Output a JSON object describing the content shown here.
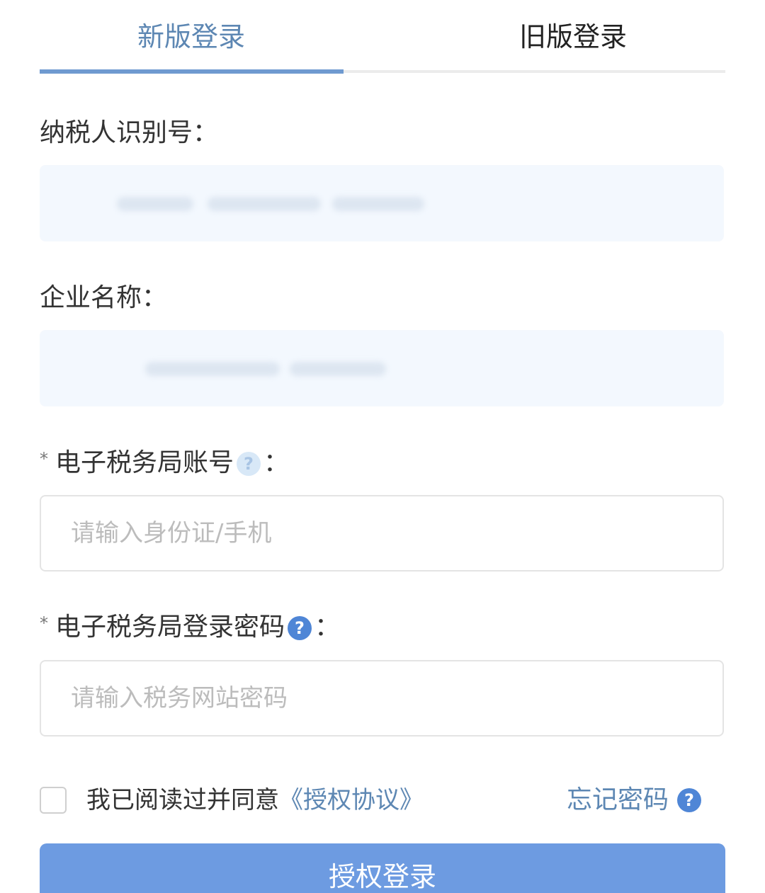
{
  "tabs": {
    "new_label": "新版登录",
    "old_label": "旧版登录"
  },
  "taxpayer_id": {
    "label": "纳税人识别号："
  },
  "company_name": {
    "label": "企业名称："
  },
  "etax_account": {
    "required_mark": "*",
    "label": "电子税务局账号",
    "colon": "：",
    "placeholder": "请输入身份证/手机"
  },
  "etax_password": {
    "required_mark": "*",
    "label": "电子税务局登录密码",
    "colon": "：",
    "placeholder": "请输入税务网站密码"
  },
  "help_glyph": "?",
  "agreement": {
    "text": "我已阅读过并同意",
    "link": "《授权协议》"
  },
  "forgot_password": "忘记密码",
  "submit_label": "授权登录",
  "colors": {
    "accent": "#5d87b3",
    "button": "#6d9be1",
    "readonly_field": "#f3f8fe"
  }
}
